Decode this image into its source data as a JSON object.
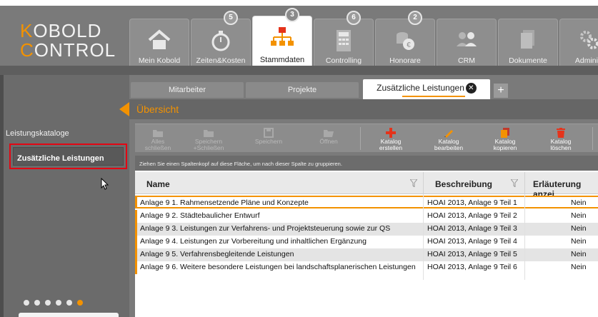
{
  "app": {
    "logo_line1": "KOBOLD",
    "logo_line2": "CONTROL",
    "accent": "#f39200",
    "highlight": "#e30613"
  },
  "nav": {
    "tabs": [
      {
        "label": "Mein Kobold",
        "icon": "home-icon",
        "badge": ""
      },
      {
        "label": "Zeiten&Kosten",
        "icon": "stopwatch-icon",
        "badge": "5"
      },
      {
        "label": "Stammdaten",
        "icon": "org-chart-icon",
        "badge": "3"
      },
      {
        "label": "Controlling",
        "icon": "calculator-icon",
        "badge": "6"
      },
      {
        "label": "Honorare",
        "icon": "coins-icon",
        "badge": "2"
      },
      {
        "label": "CRM",
        "icon": "people-icon",
        "badge": ""
      },
      {
        "label": "Dokumente",
        "icon": "documents-icon",
        "badge": ""
      },
      {
        "label": "Administ",
        "icon": "gears-icon",
        "badge": ""
      }
    ]
  },
  "sidebar": {
    "items": [
      {
        "label": "Leistungskataloge"
      },
      {
        "label": "Zusätzliche Leistungen"
      }
    ],
    "page_dots": 6,
    "active_dot": 6
  },
  "subtabs": {
    "items": [
      {
        "label": "Mitarbeiter"
      },
      {
        "label": "Projekte"
      },
      {
        "label": "Zusätzliche Leistungen"
      }
    ],
    "close_glyph": "✕",
    "add_glyph": "+"
  },
  "section": {
    "title": "Übersicht"
  },
  "toolbar": {
    "buttons": [
      {
        "label1": "Alles",
        "label2": "schließen",
        "icon": "folder-close-icon",
        "enabled": false
      },
      {
        "label1": "Speichern",
        "label2": "+Schließen",
        "icon": "folder-save-icon",
        "enabled": false
      },
      {
        "label1": "Speichern",
        "label2": "",
        "icon": "save-icon",
        "enabled": false
      },
      {
        "label1": "Öffnen",
        "label2": "",
        "icon": "folder-open-icon",
        "enabled": false
      },
      {
        "label1": "Katalog",
        "label2": "erstellen",
        "icon": "plus-icon",
        "enabled": true
      },
      {
        "label1": "Katalog",
        "label2": "bearbeiten",
        "icon": "pencil-icon",
        "enabled": true
      },
      {
        "label1": "Katalog",
        "label2": "kopieren",
        "icon": "copy-icon",
        "enabled": true
      },
      {
        "label1": "Katalog",
        "label2": "löschen",
        "icon": "trash-icon",
        "enabled": true
      }
    ]
  },
  "grid": {
    "group_hint": "Ziehen Sie einen Spaltenkopf auf diese Fläche, um nach dieser Spalte zu gruppieren.",
    "columns": [
      "Name",
      "Beschreibung",
      "Erläuterung anzei"
    ],
    "rows": [
      {
        "name": "Anlage 9 1. Rahmensetzende Pläne und Konzepte",
        "desc": "HOAI 2013, Anlage 9 Teil 1",
        "expl": "Nein"
      },
      {
        "name": "Anlage 9 2. Städtebaulicher Entwurf",
        "desc": "HOAI 2013, Anlage 9 Teil 2",
        "expl": "Nein"
      },
      {
        "name": "Anlage 9 3. Leistungen zur Verfahrens- und Projektsteuerung sowie zur QS",
        "desc": "HOAI 2013, Anlage 9 Teil 3",
        "expl": "Nein"
      },
      {
        "name": "Anlage 9 4. Leistungen zur Vorbereitung und inhaltlichen Ergänzung",
        "desc": "HOAI 2013, Anlage 9 Teil 4",
        "expl": "Nein"
      },
      {
        "name": "Anlage 9 5. Verfahrensbegleitende Leistungen",
        "desc": "HOAI 2013, Anlage 9 Teil 5",
        "expl": "Nein"
      },
      {
        "name": "Anlage 9 6. Weitere besondere Leistungen bei landschaftsplanerischen Leistungen",
        "desc": "HOAI 2013, Anlage 9 Teil 6",
        "expl": "Nein"
      }
    ]
  }
}
